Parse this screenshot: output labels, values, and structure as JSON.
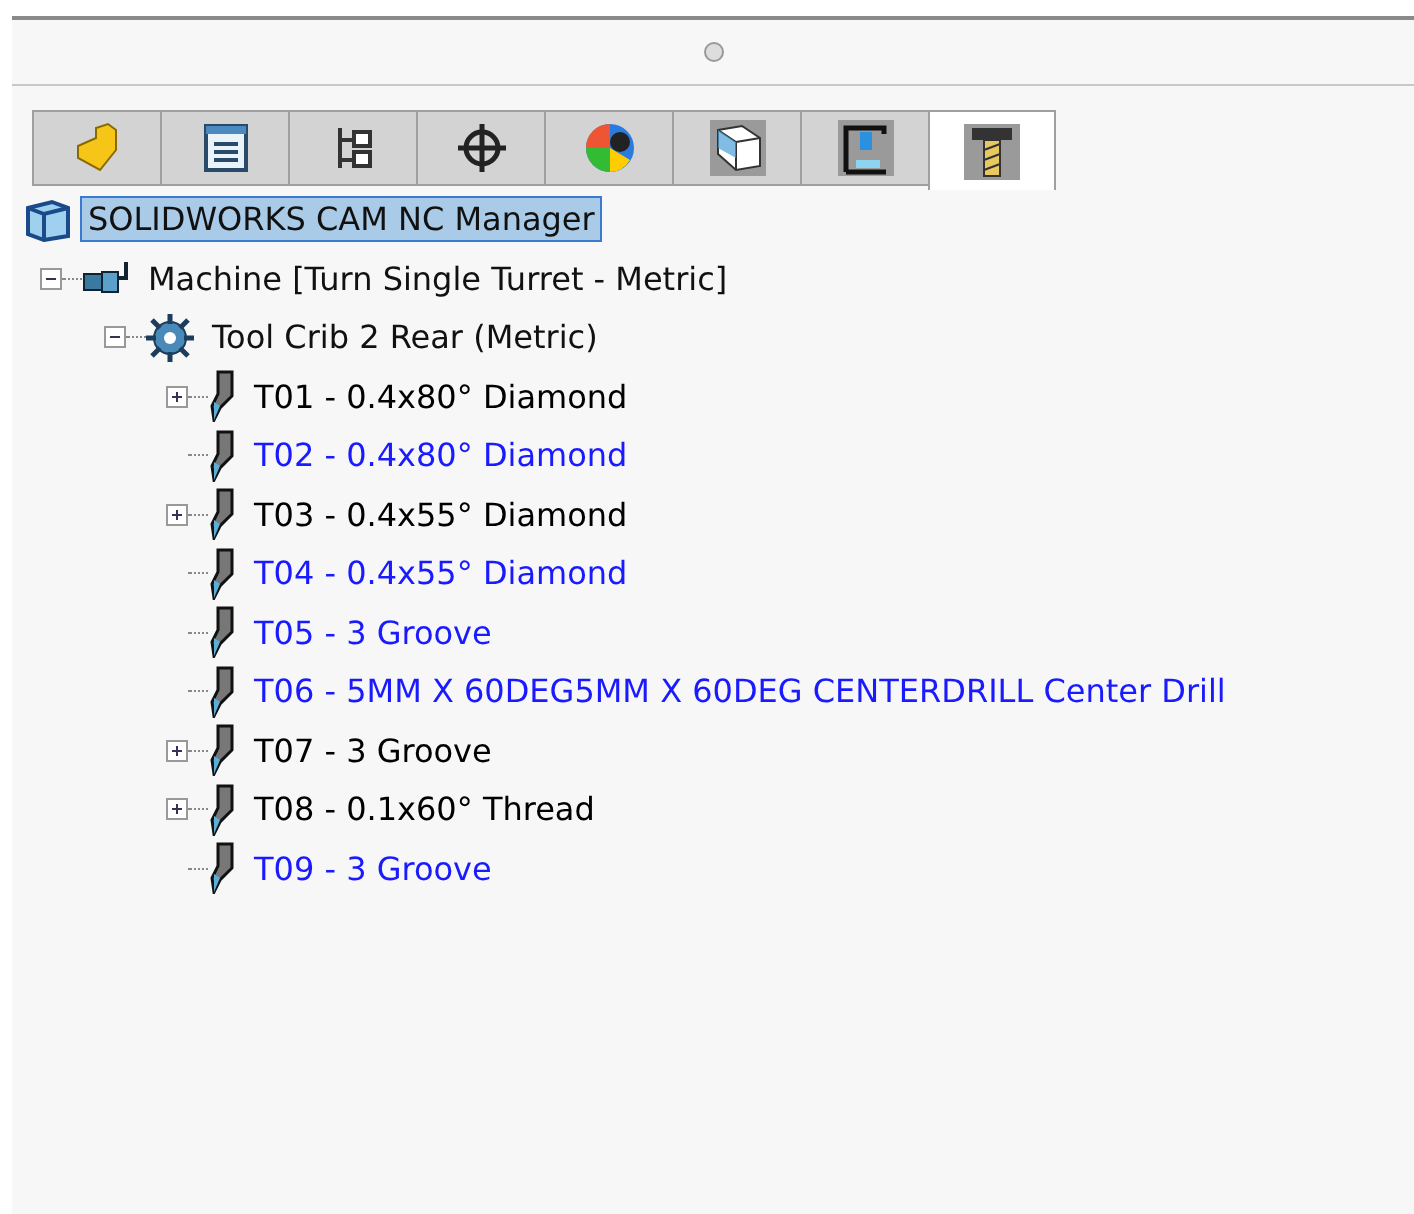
{
  "tabs": [
    {
      "selected": false
    },
    {
      "selected": false
    },
    {
      "selected": false
    },
    {
      "selected": false
    },
    {
      "selected": false
    },
    {
      "selected": false
    },
    {
      "selected": false
    },
    {
      "selected": true
    }
  ],
  "tree": {
    "label": "SOLIDWORKS CAM NC Manager",
    "selected": true,
    "children": [
      {
        "label": "Machine [Turn Single Turret - Metric]",
        "expanded": true,
        "children": [
          {
            "label": "Tool Crib 2 Rear (Metric)",
            "expanded": true,
            "children": [
              {
                "label": "T01 - 0.4x80° Diamond",
                "expandable": true,
                "color": "#000000"
              },
              {
                "label": "T02 - 0.4x80° Diamond",
                "expandable": false,
                "color": "#1a1aff"
              },
              {
                "label": "T03 - 0.4x55° Diamond",
                "expandable": true,
                "color": "#000000"
              },
              {
                "label": "T04 - 0.4x55° Diamond",
                "expandable": false,
                "color": "#1a1aff"
              },
              {
                "label": "T05 - 3 Groove",
                "expandable": false,
                "color": "#1a1aff"
              },
              {
                "label": "T06 - 5MM X 60DEG5MM X 60DEG CENTERDRILL Center Drill",
                "expandable": false,
                "color": "#1a1aff"
              },
              {
                "label": "T07 - 3 Groove",
                "expandable": true,
                "color": "#000000"
              },
              {
                "label": "T08 - 0.1x60° Thread",
                "expandable": true,
                "color": "#000000"
              },
              {
                "label": "T09 - 3 Groove",
                "expandable": false,
                "color": "#1a1aff"
              }
            ]
          }
        ]
      }
    ]
  }
}
